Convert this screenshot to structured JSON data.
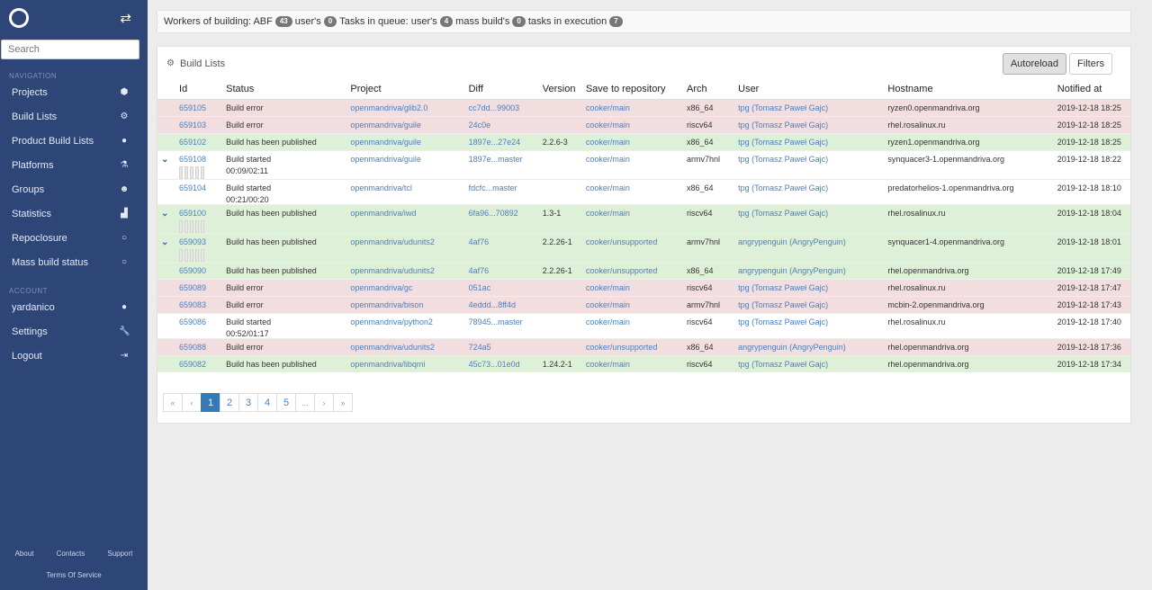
{
  "sidebar": {
    "search_placeholder": "Search",
    "nav_section": "NAVIGATION",
    "account_section": "ACCOUNT",
    "nav_items": [
      {
        "label": "Projects",
        "icon": "cube-icon"
      },
      {
        "label": "Build Lists",
        "icon": "gears-icon"
      },
      {
        "label": "Product Build Lists",
        "icon": "product-icon"
      },
      {
        "label": "Platforms",
        "icon": "flask-icon"
      },
      {
        "label": "Groups",
        "icon": "users-icon"
      },
      {
        "label": "Statistics",
        "icon": "chart-icon"
      },
      {
        "label": "Repoclosure",
        "icon": "circle-icon"
      },
      {
        "label": "Mass build status",
        "icon": "circle-icon"
      }
    ],
    "account_items": [
      {
        "label": "yardanico",
        "icon": "user-icon"
      },
      {
        "label": "Settings",
        "icon": "wrench-icon"
      },
      {
        "label": "Logout",
        "icon": "logout-icon"
      }
    ],
    "footer": {
      "about": "About",
      "contacts": "Contacts",
      "support": "Support",
      "tos": "Terms Of Service"
    }
  },
  "workers": {
    "t1": "Workers of building: ABF",
    "abf": "43",
    "t2": "user's",
    "users": "0",
    "t3": "Tasks in queue: user's",
    "queue_users": "4",
    "t4": "mass build's",
    "queue_mass": "0",
    "t5": "tasks in execution",
    "exec": "7"
  },
  "panel": {
    "title": "Build Lists",
    "autoreload": "Autoreload",
    "filters": "Filters"
  },
  "columns": [
    "Id",
    "Status",
    "Project",
    "Diff",
    "Version",
    "Save to repository",
    "Arch",
    "User",
    "Hostname",
    "Notified at"
  ],
  "rows": [
    {
      "state": "error",
      "caret": false,
      "id": "659105",
      "status": "Build error",
      "sub": "",
      "bars": false,
      "project": "openmandriva/glib2.0",
      "diff": "cc7dd...99003",
      "version": "",
      "repo": "cooker/main",
      "arch": "x86_64",
      "user": "tpg (Tomasz Paweł Gajc)",
      "host": "ryzen0.openmandriva.org",
      "notified": "2019-12-18 18:25"
    },
    {
      "state": "error",
      "caret": false,
      "id": "659103",
      "status": "Build error",
      "sub": "",
      "bars": false,
      "project": "openmandriva/guile",
      "diff": "24c0e",
      "version": "",
      "repo": "cooker/main",
      "arch": "riscv64",
      "user": "tpg (Tomasz Paweł Gajc)",
      "host": "rhel.rosalinux.ru",
      "notified": "2019-12-18 18:25"
    },
    {
      "state": "success",
      "caret": false,
      "id": "659102",
      "status": "Build has been published",
      "sub": "",
      "bars": false,
      "project": "openmandriva/guile",
      "diff": "1897e...27e24",
      "version": "2.2.6-3",
      "repo": "cooker/main",
      "arch": "x86_64",
      "user": "tpg (Tomasz Paweł Gajc)",
      "host": "ryzen1.openmandriva.org",
      "notified": "2019-12-18 18:25"
    },
    {
      "state": "plain",
      "caret": true,
      "id": "659108",
      "status": "Build started",
      "sub": "00:09/02:11",
      "bars": true,
      "project": "openmandriva/guile",
      "diff": "1897e...master",
      "version": "",
      "repo": "cooker/main",
      "arch": "armv7hnl",
      "user": "tpg (Tomasz Paweł Gajc)",
      "host": "synquacer3-1.openmandriva.org",
      "notified": "2019-12-18 18:22"
    },
    {
      "state": "plain",
      "caret": false,
      "id": "659104",
      "status": "Build started",
      "sub": "00:21/00:20",
      "bars": false,
      "project": "openmandriva/tcl",
      "diff": "fdcfc...master",
      "version": "",
      "repo": "cooker/main",
      "arch": "x86_64",
      "user": "tpg (Tomasz Paweł Gajc)",
      "host": "predatorhelios-1.openmandriva.org",
      "notified": "2019-12-18 18:10"
    },
    {
      "state": "success",
      "caret": true,
      "id": "659100",
      "status": "Build has been published",
      "sub": "",
      "bars": true,
      "project": "openmandriva/iwd",
      "diff": "6fa96...70892",
      "version": "1.3-1",
      "repo": "cooker/main",
      "arch": "riscv64",
      "user": "tpg (Tomasz Paweł Gajc)",
      "host": "rhel.rosalinux.ru",
      "notified": "2019-12-18 18:04"
    },
    {
      "state": "success",
      "caret": true,
      "id": "659093",
      "status": "Build has been published",
      "sub": "",
      "bars": true,
      "project": "openmandriva/udunits2",
      "diff": "4af76",
      "version": "2.2.26-1",
      "repo": "cooker/unsupported",
      "arch": "armv7hnl",
      "user": "angrypenguin (AngryPenguin)",
      "host": "synquacer1-4.openmandriva.org",
      "notified": "2019-12-18 18:01"
    },
    {
      "state": "success",
      "caret": false,
      "id": "659090",
      "status": "Build has been published",
      "sub": "",
      "bars": false,
      "project": "openmandriva/udunits2",
      "diff": "4af76",
      "version": "2.2.26-1",
      "repo": "cooker/unsupported",
      "arch": "x86_64",
      "user": "angrypenguin (AngryPenguin)",
      "host": "rhel.openmandriva.org",
      "notified": "2019-12-18 17:49"
    },
    {
      "state": "error",
      "caret": false,
      "id": "659089",
      "status": "Build error",
      "sub": "",
      "bars": false,
      "project": "openmandriva/gc",
      "diff": "051ac",
      "version": "",
      "repo": "cooker/main",
      "arch": "riscv64",
      "user": "tpg (Tomasz Paweł Gajc)",
      "host": "rhel.rosalinux.ru",
      "notified": "2019-12-18 17:47"
    },
    {
      "state": "error",
      "caret": false,
      "id": "659083",
      "status": "Build error",
      "sub": "",
      "bars": false,
      "project": "openmandriva/bison",
      "diff": "4eddd...8ff4d",
      "version": "",
      "repo": "cooker/main",
      "arch": "armv7hnl",
      "user": "tpg (Tomasz Paweł Gajc)",
      "host": "mcbin-2.openmandriva.org",
      "notified": "2019-12-18 17:43"
    },
    {
      "state": "plain",
      "caret": false,
      "id": "659086",
      "status": "Build started",
      "sub": "00:52/01:17",
      "bars": false,
      "project": "openmandriva/python2",
      "diff": "78945...master",
      "version": "",
      "repo": "cooker/main",
      "arch": "riscv64",
      "user": "tpg (Tomasz Paweł Gajc)",
      "host": "rhel.rosalinux.ru",
      "notified": "2019-12-18 17:40"
    },
    {
      "state": "error",
      "caret": false,
      "id": "659088",
      "status": "Build error",
      "sub": "",
      "bars": false,
      "project": "openmandriva/udunits2",
      "diff": "724a5",
      "version": "",
      "repo": "cooker/unsupported",
      "arch": "x86_64",
      "user": "angrypenguin (AngryPenguin)",
      "host": "rhel.openmandriva.org",
      "notified": "2019-12-18 17:36"
    },
    {
      "state": "success",
      "caret": false,
      "id": "659082",
      "status": "Build has been published",
      "sub": "",
      "bars": false,
      "project": "openmandriva/libqmi",
      "diff": "45c73...01e0d",
      "version": "1.24.2-1",
      "repo": "cooker/main",
      "arch": "riscv64",
      "user": "tpg (Tomasz Paweł Gajc)",
      "host": "rhel.openmandriva.org",
      "notified": "2019-12-18 17:34"
    }
  ],
  "pagination": [
    "«",
    "‹",
    "1",
    "2",
    "3",
    "4",
    "5",
    "...",
    "›",
    "»"
  ],
  "pagination_current": "1",
  "colors": {
    "sidebar": "#2d4577",
    "error_row": "#f2dede",
    "success_row": "#dff0d8",
    "link": "#4a7fc1",
    "active_page": "#337ab7"
  }
}
